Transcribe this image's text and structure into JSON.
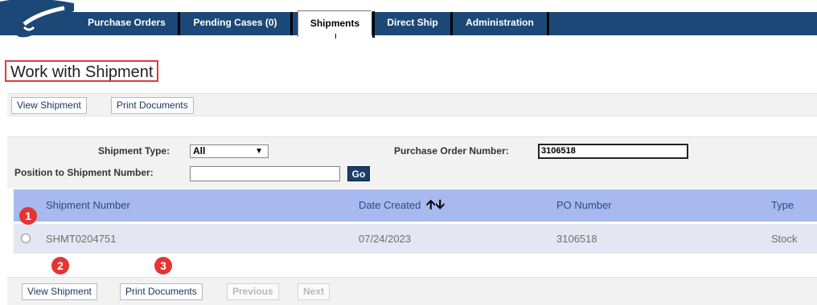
{
  "nav": {
    "tabs": [
      {
        "label": "Purchase Orders"
      },
      {
        "label": "Pending Cases (0)"
      },
      {
        "label": "Shipments"
      },
      {
        "label": "Direct Ship"
      },
      {
        "label": "Administration"
      }
    ]
  },
  "page": {
    "title": "Work with Shipment"
  },
  "top_toolbar": {
    "view_label": "View Shipment",
    "print_label": "Print Documents"
  },
  "filters": {
    "shipment_type_label": "Shipment Type:",
    "shipment_type_value": "All",
    "po_number_label": "Purchase Order Number:",
    "po_number_value": "3106518",
    "position_label": "Position to Shipment Number:",
    "position_value": "",
    "go_label": "Go"
  },
  "table": {
    "columns": {
      "shipment_number": "Shipment Number",
      "date_created": "Date Created",
      "po_number": "PO Number",
      "type": "Type"
    },
    "rows": [
      {
        "shipment_number": "SHMT0204751",
        "date_created": "07/24/2023",
        "po_number": "3106518",
        "type": "Stock"
      }
    ]
  },
  "bottom_toolbar": {
    "view_label": "View Shipment",
    "print_label": "Print Documents",
    "previous_label": "Previous",
    "next_label": "Next"
  },
  "annotations": {
    "one": "1",
    "two": "2",
    "three": "3",
    "color": "#e53434"
  },
  "colors": {
    "nav": "#1c4878",
    "header_row": "#a7b9ee",
    "data_row": "#e4e7f1",
    "highlight": "#e0393e"
  }
}
